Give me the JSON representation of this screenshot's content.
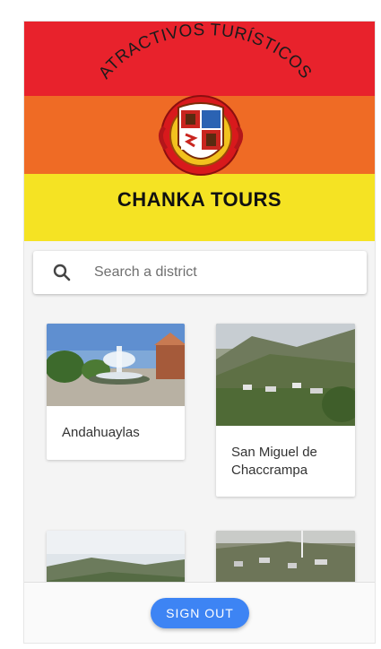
{
  "banner": {
    "arc_text": "ATRACTIVOS TURÍSTICOS",
    "brand": "CHANKA TOURS",
    "colors": {
      "red": "#e8222c",
      "orange": "#ef6b25",
      "yellow": "#f5e323"
    }
  },
  "search": {
    "placeholder": "Search a district",
    "icon": "search-icon"
  },
  "districts": [
    {
      "name": "Andahuaylas"
    },
    {
      "name": "San Miguel de Chaccrampa"
    },
    {
      "name": ""
    },
    {
      "name": ""
    }
  ],
  "footer": {
    "signout_label": "SIGN OUT",
    "accent": "#3d84f4"
  }
}
